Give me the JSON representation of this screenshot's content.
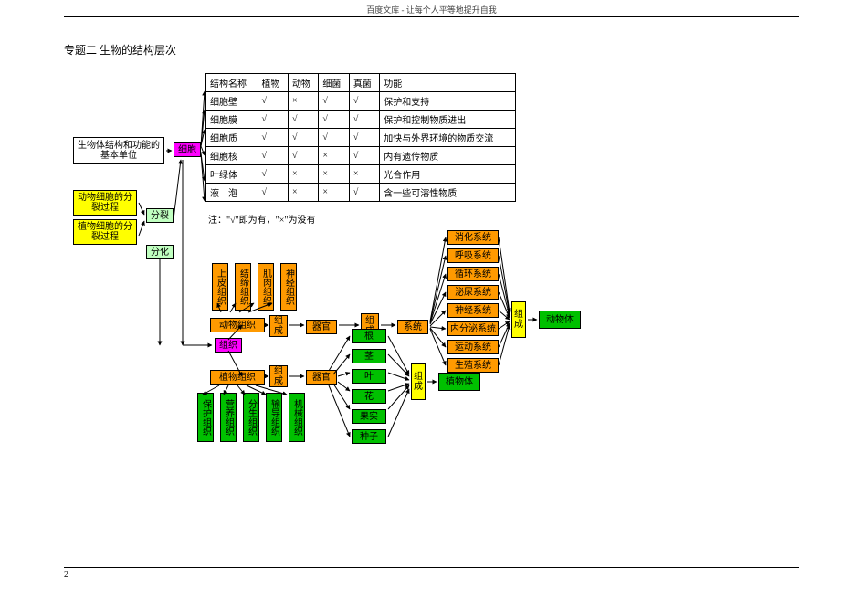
{
  "header": "百度文库 - 让每个人平等地提升自我",
  "title": "专题二 生物的结构层次",
  "pageNum": "2",
  "table": {
    "headers": [
      "结构名称",
      "植物",
      "动物",
      "细菌",
      "真菌",
      "功能"
    ],
    "rows": [
      [
        "细胞壁",
        "√",
        "×",
        "√",
        "√",
        "保护和支持"
      ],
      [
        "细胞膜",
        "√",
        "√",
        "√",
        "√",
        "保护和控制物质进出"
      ],
      [
        "细胞质",
        "√",
        "√",
        "√",
        "√",
        "加快与外界环境的物质交流"
      ],
      [
        "细胞核",
        "√",
        "√",
        "×",
        "√",
        "内有遗传物质"
      ],
      [
        "叶绿体",
        "√",
        "×",
        "×",
        "×",
        "光合作用"
      ],
      [
        "液　泡",
        "√",
        "×",
        "×",
        "√",
        "含一些可溶性物质"
      ]
    ],
    "note": "注：\"√\"即为有，\"×\"为没有"
  },
  "nodes": {
    "basicUnit": "生物体结构和功能的基本单位",
    "cell": "细胞",
    "animalCellDiv": "动物细胞的分裂过程",
    "plantCellDiv": "植物细胞的分裂过程",
    "split": "分裂",
    "differentiate": "分化",
    "animalTissue": "动物组织",
    "plantTissue": "植物组织",
    "compose1": "组成",
    "compose2": "组成",
    "compose3": "组成",
    "compose4": "组成",
    "compose5": "组成",
    "organ1": "器官",
    "organ2": "器官",
    "system": "系统",
    "tissue": "组织",
    "animalBody": "动物体",
    "plantBody": "植物体",
    "animalTissues": [
      "上皮组织",
      "结缔组织",
      "肌肉组织",
      "神经组织"
    ],
    "plantTissues": [
      "保护组织",
      "营养组织",
      "分生组织",
      "输导组织",
      "机械组织"
    ],
    "plantOrgans": [
      "根",
      "茎",
      "叶",
      "花",
      "果实",
      "种子"
    ],
    "systems": [
      "消化系统",
      "呼吸系统",
      "循环系统",
      "泌尿系统",
      "神经系统",
      "内分泌系统",
      "运动系统",
      "生殖系统"
    ]
  }
}
